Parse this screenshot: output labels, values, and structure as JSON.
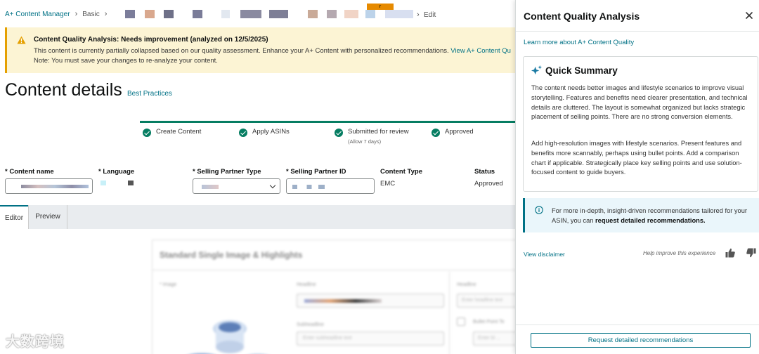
{
  "breadcrumb": {
    "root": "A+ Content Manager",
    "type": "Basic",
    "current": "Edit",
    "tag": "r"
  },
  "banner": {
    "title": "Content Quality Analysis: Needs improvement (analyzed on 12/5/2025)",
    "line1": "This content is currently partially collapsed based on our quality assessment. Enhance your A+ Content with personalized recommendations.",
    "link": "View A+ Content Qu",
    "line2": "Note: You must save your changes to re-analyze your content."
  },
  "header": {
    "title": "Content details",
    "best_practices": "Best Practices"
  },
  "progress": {
    "steps": [
      {
        "label": "Create Content",
        "sub": ""
      },
      {
        "label": "Apply ASINs",
        "sub": ""
      },
      {
        "label": "Submitted for review",
        "sub": "(Allow 7 days)"
      },
      {
        "label": "Approved",
        "sub": ""
      }
    ]
  },
  "form": {
    "content_name_label": "* Content name",
    "language_label": "* Language",
    "partner_type_label": "* Selling Partner Type",
    "partner_id_label": "* Selling Partner ID",
    "content_type_label": "Content Type",
    "content_type_value": "EMC",
    "status_label": "Status",
    "status_value": "Approved"
  },
  "tabs": {
    "editor": "Editor",
    "preview": "Preview"
  },
  "module": {
    "title": "Standard Single Image & Highlights",
    "image_label": "* Image",
    "headline_label": "Headline",
    "subheadline_label": "Subheadline",
    "headline2_label": "Headline",
    "subheadline_placeholder": "Enter subheadline text",
    "headline2_placeholder": "Enter headline text",
    "bullet_label": "Bullet Point Te",
    "bullet_placeholder": "Enter bl ..."
  },
  "watermark": "大数跨境",
  "panel": {
    "title": "Content Quality Analysis",
    "learn_more": "Learn more about A+ Content Quality",
    "summary_title": "Quick Summary",
    "summary_p1": "The content needs better images and lifestyle scenarios to improve visual storytelling. Features and benefits need clearer presentation, and technical details are cluttered. The layout is somewhat organized but lacks strategic placement of selling points. There are no strong conversion elements.",
    "summary_p2": "Add high-resolution images with lifestyle scenarios. Present features and benefits more scannably, perhaps using bullet points. Add a comparison chart if applicable. Strategically place key selling points and use solution-focused content to guide buyers.",
    "info_text_prefix": "For more in-depth, insight-driven recommendations tailored for your ASIN, you can",
    "info_text_bold": "request detailed recommendations.",
    "disclaimer": "View disclaimer",
    "help_text": "Help improve this experience",
    "request_button": "Request detailed recommendations"
  },
  "colors": {
    "link": "#007185",
    "success": "#067d62",
    "warning_bg": "#fcf4d4",
    "warning_accent": "#e5a000",
    "info_bg": "#eaf6fb"
  },
  "icons": [
    "warning-icon",
    "check-circle-icon",
    "chevron-down-icon",
    "close-icon",
    "sparkle-icon",
    "info-icon",
    "thumbs-up-icon",
    "thumbs-down-icon"
  ]
}
